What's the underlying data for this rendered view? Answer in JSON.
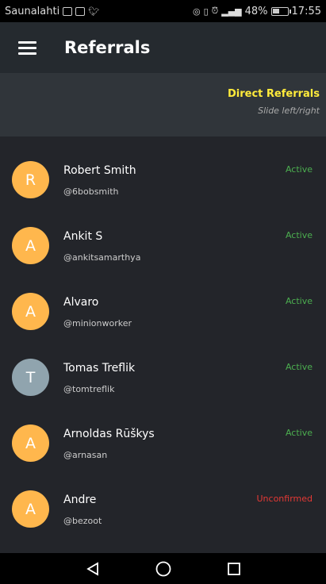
{
  "status_bar": {
    "carrier": "Saunalahti",
    "battery": "48%",
    "time": "17:55",
    "battery_level": 0.48
  },
  "header": {
    "title": "Referrals",
    "menu_icon": "hamburger-menu-icon"
  },
  "tab": {
    "label": "Direct Referrals",
    "hint": "Slide left/right"
  },
  "colors": {
    "accent": "#ffeb3b",
    "active": "#4caf50",
    "unconfirmed": "#e53935",
    "avatar_orange": "#ffb74d",
    "avatar_grey": "#90a4ae"
  },
  "referrals": [
    {
      "initial": "R",
      "name": "Robert Smith",
      "handle": "@6bobsmith",
      "status": "Active",
      "status_color": "#4caf50",
      "avatar_color": "#ffb74d"
    },
    {
      "initial": "A",
      "name": "Ankit S",
      "handle": "@ankitsamarthya",
      "status": "Active",
      "status_color": "#4caf50",
      "avatar_color": "#ffb74d"
    },
    {
      "initial": "A",
      "name": "Alvaro",
      "handle": "@minionworker",
      "status": "Active",
      "status_color": "#4caf50",
      "avatar_color": "#ffb74d"
    },
    {
      "initial": "T",
      "name": "Tomas Treflik",
      "handle": "@tomtreflik",
      "status": "Active",
      "status_color": "#4caf50",
      "avatar_color": "#90a4ae"
    },
    {
      "initial": "A",
      "name": "Arnoldas Rūškys",
      "handle": "@arnasan",
      "status": "Active",
      "status_color": "#4caf50",
      "avatar_color": "#ffb74d"
    },
    {
      "initial": "A",
      "name": "Andre",
      "handle": "@bezoot",
      "status": "Unconfirmed",
      "status_color": "#e53935",
      "avatar_color": "#ffb74d"
    }
  ],
  "nav": {
    "back_icon": "back-triangle-icon",
    "home_icon": "home-circle-icon",
    "recents_icon": "recents-square-icon"
  }
}
